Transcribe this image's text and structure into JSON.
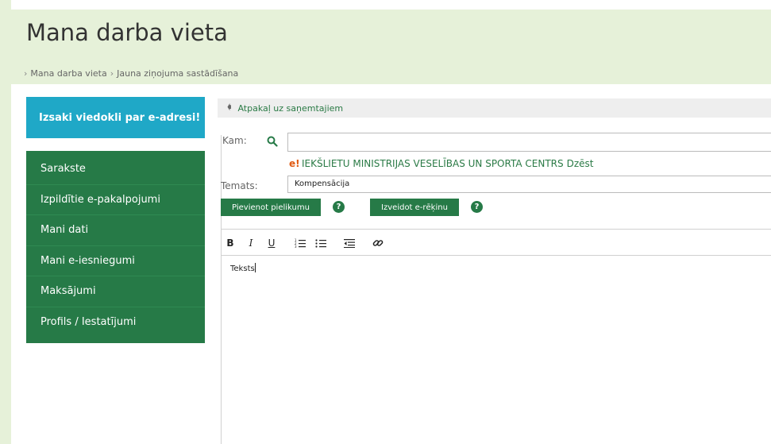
{
  "header": {
    "title": "Mana darba vieta",
    "breadcrumb": [
      "Mana darba vieta",
      "Jauna ziņojuma sastādīšana"
    ]
  },
  "sidebar": {
    "feedback_label": "Izsaki viedokli par e-adresi!",
    "items": [
      {
        "label": "Sarakste"
      },
      {
        "label": "Izpildītie e-pakalpojumi"
      },
      {
        "label": "Mani dati"
      },
      {
        "label": "Mani e-iesniegumi"
      },
      {
        "label": "Maksājumi"
      },
      {
        "label": "Profils / Iestatījumi"
      }
    ]
  },
  "compose": {
    "back_label": "Atpakaļ uz saņemtajiem",
    "to_label": "Kam:",
    "to_value": "",
    "recipient_name": "IEKŠLIETU MINISTRIJAS VESELĪBAS UN SPORTA CENTRS",
    "recipient_delete": "Dzēst",
    "subject_label": "Temats:",
    "subject_value": "Kompensācija",
    "attach_label": "Pievienot pielikumu",
    "invoice_label": "Izveidot e-rēķinu",
    "help_glyph": "?",
    "body_text": "Teksts"
  },
  "toolbar": {
    "bold": "B",
    "italic": "I",
    "underline": "U"
  },
  "colors": {
    "accent_green": "#267a47",
    "feedback_blue": "#1fa8c7",
    "header_bg": "#e6f1d9"
  },
  "icons": [
    "search-icon",
    "back-arrow-icon",
    "recipient-eaddress-icon",
    "ordered-list-icon",
    "unordered-list-icon",
    "outdent-icon",
    "link-icon",
    "help-icon"
  ]
}
